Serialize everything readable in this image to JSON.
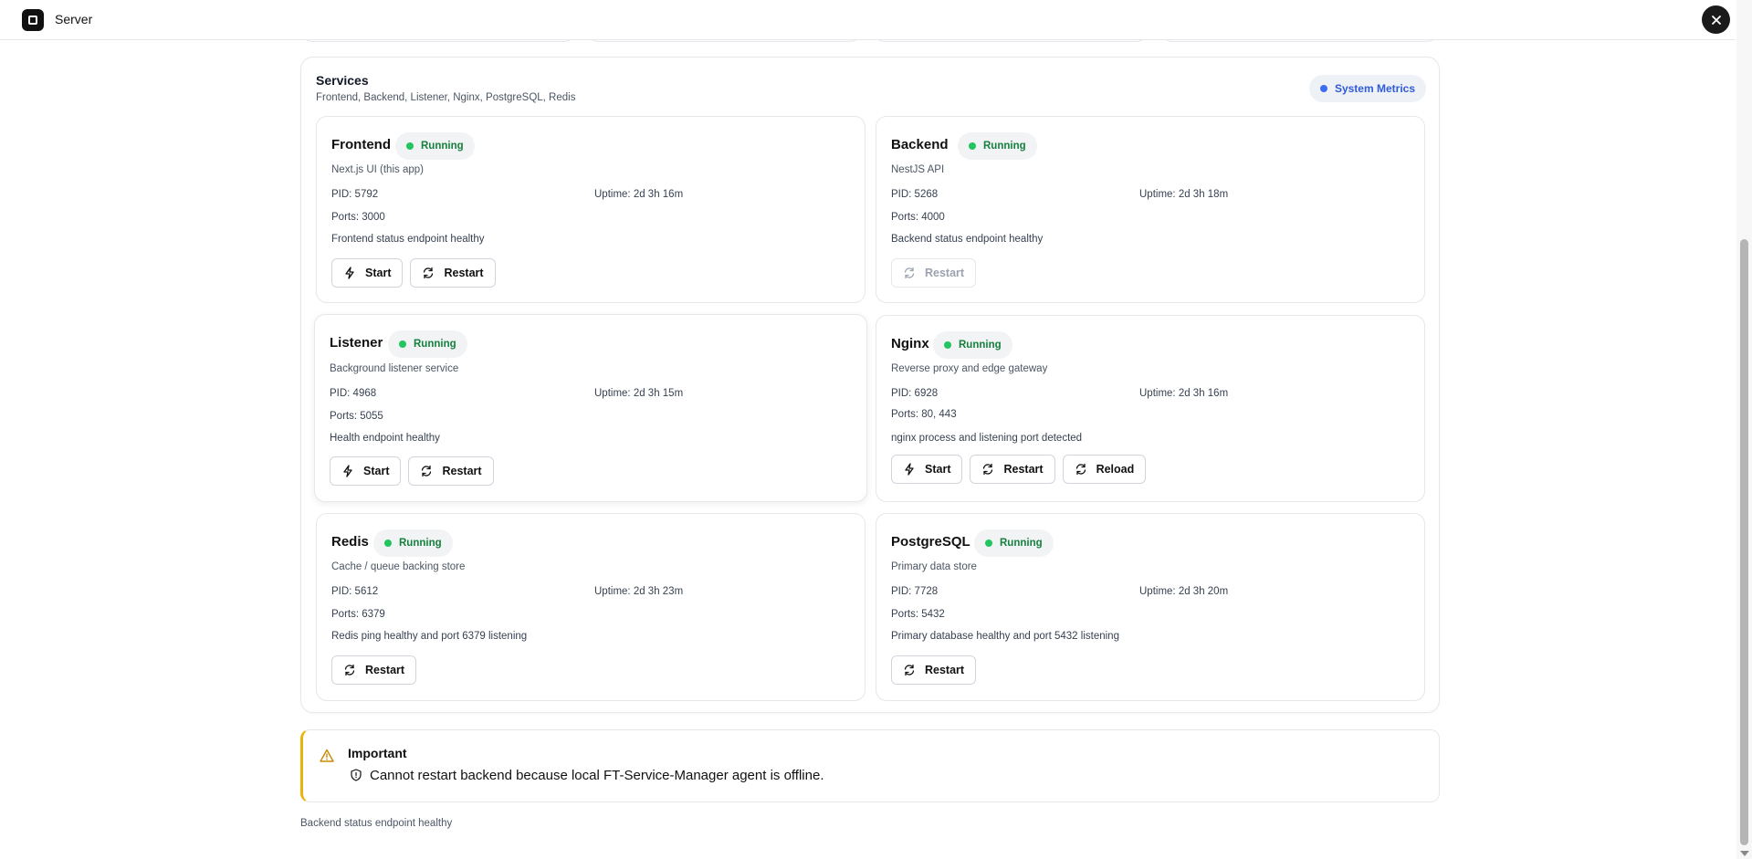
{
  "header": {
    "title": "Server"
  },
  "services": {
    "title": "Services",
    "subtitle": "Frontend, Backend, Listener, Nginx, PostgreSQL, Redis",
    "metrics_button": "System Metrics",
    "cards": [
      {
        "name": "Frontend",
        "status": "Running",
        "description": "Next.js UI (this app)",
        "pid": "PID: 5792",
        "uptime": "Uptime: 2d 3h 16m",
        "ports": "Ports: 3000",
        "health": "Frontend status endpoint healthy",
        "buttons": [
          "Start",
          "Restart"
        ]
      },
      {
        "name": "Backend",
        "status": "Running",
        "description": "NestJS API",
        "pid": "PID: 5268",
        "uptime": "Uptime: 2d 3h 18m",
        "ports": "Ports: 4000",
        "health": "Backend status endpoint healthy",
        "buttons": [
          "Restart"
        ]
      },
      {
        "name": "Listener",
        "status": "Running",
        "description": "Background listener service",
        "pid": "PID: 4968",
        "uptime": "Uptime: 2d 3h 15m",
        "ports": "Ports: 5055",
        "health": "Health endpoint healthy",
        "buttons": [
          "Start",
          "Restart"
        ]
      },
      {
        "name": "Nginx",
        "status": "Running",
        "description": "Reverse proxy and edge gateway",
        "pid": "PID: 6928",
        "uptime": "Uptime: 2d 3h 16m",
        "ports": "Ports: 80, 443",
        "health": "nginx process and listening port detected",
        "buttons": [
          "Start",
          "Restart",
          "Reload"
        ]
      },
      {
        "name": "Redis",
        "status": "Running",
        "description": "Cache / queue backing store",
        "pid": "PID: 5612",
        "uptime": "Uptime: 2d 3h 23m",
        "ports": "Ports: 6379",
        "health": "Redis ping healthy and port 6379 listening",
        "buttons": [
          "Restart"
        ]
      },
      {
        "name": "PostgreSQL",
        "status": "Running",
        "description": "Primary data store",
        "pid": "PID: 7728",
        "uptime": "Uptime: 2d 3h 20m",
        "ports": "Ports: 5432",
        "health": "Primary database healthy and port 5432 listening",
        "buttons": [
          "Restart"
        ]
      }
    ]
  },
  "alert": {
    "title": "Important",
    "message": "Cannot restart backend because local FT-Service-Manager agent is offline."
  },
  "footer_note": "Backend status endpoint healthy",
  "colors": {
    "running": "#22c55e",
    "accent": "#3b6ef0",
    "warning": "#eab308"
  }
}
